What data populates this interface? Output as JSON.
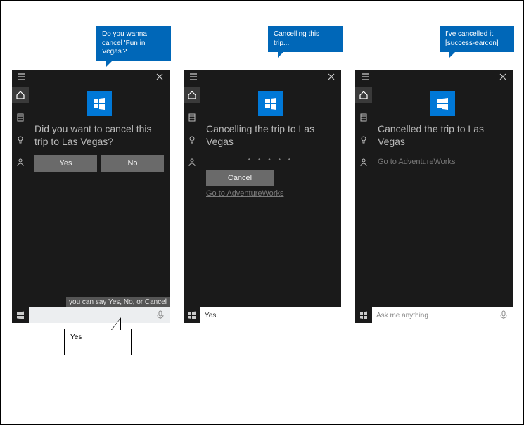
{
  "bubbles": {
    "p1": "Do you wanna cancel 'Fun in Vegas'?",
    "p2": "Cancelling this trip...",
    "p3": "I've cancelled it. [success-earcon]"
  },
  "panels": {
    "p1": {
      "heading": "Did you want to cancel this trip to Las Vegas?",
      "yes_label": "Yes",
      "no_label": "No",
      "hint": "you can say Yes, No, or Cancel",
      "search_value": ""
    },
    "p2": {
      "heading": "Cancelling the trip to Las Vegas",
      "progress": "• • • • •",
      "cancel_label": "Cancel",
      "link": "Go to AdventureWorks",
      "search_value": "Yes."
    },
    "p3": {
      "heading": "Cancelled the trip to Las Vegas",
      "link": "Go to AdventureWorks",
      "search_placeholder": "Ask me anything"
    }
  },
  "callout": {
    "text": "Yes"
  }
}
